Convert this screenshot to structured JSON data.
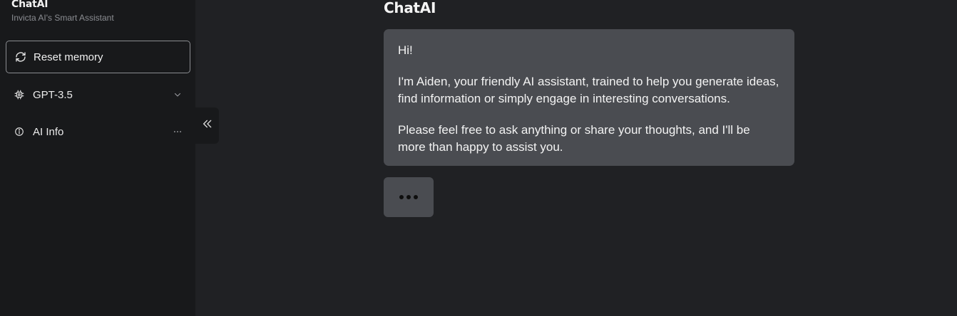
{
  "sidebar": {
    "brand_title": "ChatAI",
    "brand_subtitle": "Invicta AI's Smart Assistant",
    "reset_label": "Reset memory",
    "model_label": "GPT-3.5",
    "info_label": "AI Info",
    "icons": {
      "reset": "refresh-icon",
      "model": "chip-icon",
      "model_trail": "chevron-down-icon",
      "info": "info-icon",
      "info_trail": "more-horizontal-icon",
      "collapse": "double-chevron-left-icon"
    }
  },
  "main": {
    "title": "ChatAI",
    "message": {
      "p1": "Hi!",
      "p2": "I'm Aiden, your friendly AI assistant, trained to help you generate ideas, find information or simply engage in interesting conversations.",
      "p3": "Please feel free to ask anything or share your thoughts, and I'll be more than happy to assist you."
    }
  },
  "colors": {
    "background": "#202124",
    "sidebar": "#18191b",
    "bubble": "#4a4c51"
  }
}
